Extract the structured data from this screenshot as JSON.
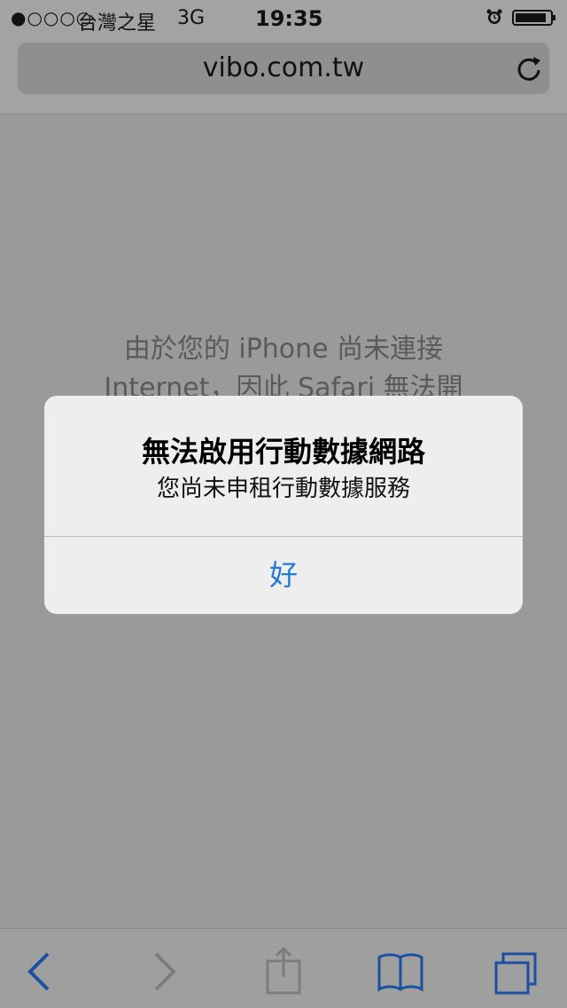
{
  "status_bar": {
    "signal": "●○○○○",
    "carrier": "台灣之星",
    "network": "3G",
    "time": "19:35"
  },
  "url_bar": {
    "domain": "vibo.com.tw"
  },
  "page": {
    "error_line1": "由於您的 iPhone 尚未連接",
    "error_line2": "Internet，因此 Safari 無法開"
  },
  "alert": {
    "title": "無法啟用行動數據網路",
    "message": "您尚未申租行動數據服務",
    "ok_label": "好"
  },
  "colors": {
    "accent_blue": "#1f7ad8",
    "dim_blue": "#1b4fa0",
    "disabled_gray": "#7c7c7c"
  },
  "toolbar": {
    "icons": [
      "back-icon",
      "forward-icon",
      "share-icon",
      "bookmarks-icon",
      "tabs-icon"
    ]
  }
}
